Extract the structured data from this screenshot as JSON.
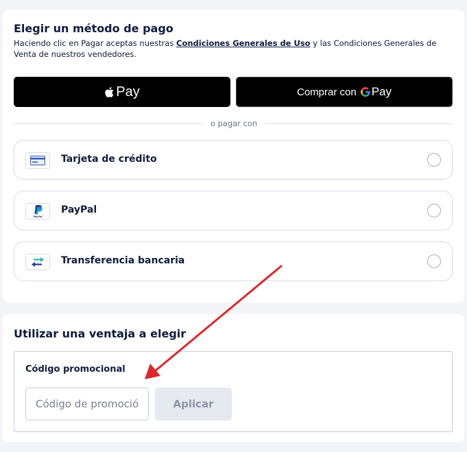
{
  "payment": {
    "title": "Elegir un método de pago",
    "subtitle_before": "Haciendo clic en Pagar aceptas nuestras ",
    "subtitle_link": "Condiciones Generales de Uso",
    "subtitle_after": " y las Condiciones Generales de Venta de nuestros vendedores.",
    "apple_pay_label": "Pay",
    "google_pay_prefix": "Comprar con",
    "google_pay_label": "Pay",
    "divider_text": "o pagar con",
    "methods": [
      {
        "label": "Tarjeta de crédito",
        "icon": "credit-card-icon"
      },
      {
        "label": "PayPal",
        "icon": "paypal-icon"
      },
      {
        "label": "Transferencia bancaria",
        "icon": "bank-transfer-icon"
      }
    ]
  },
  "promo": {
    "title": "Utilizar una ventaja a elegir",
    "field_label": "Código promocional",
    "input_placeholder": "Código de promoción",
    "input_value": "",
    "apply_label": "Aplicar"
  },
  "colors": {
    "background": "#f3f4f8",
    "card": "#ffffff",
    "text": "#0f1b3d",
    "border": "#d6dbe6",
    "annotation_arrow": "#e0262a",
    "apply_disabled_bg": "#e6e9f0"
  }
}
